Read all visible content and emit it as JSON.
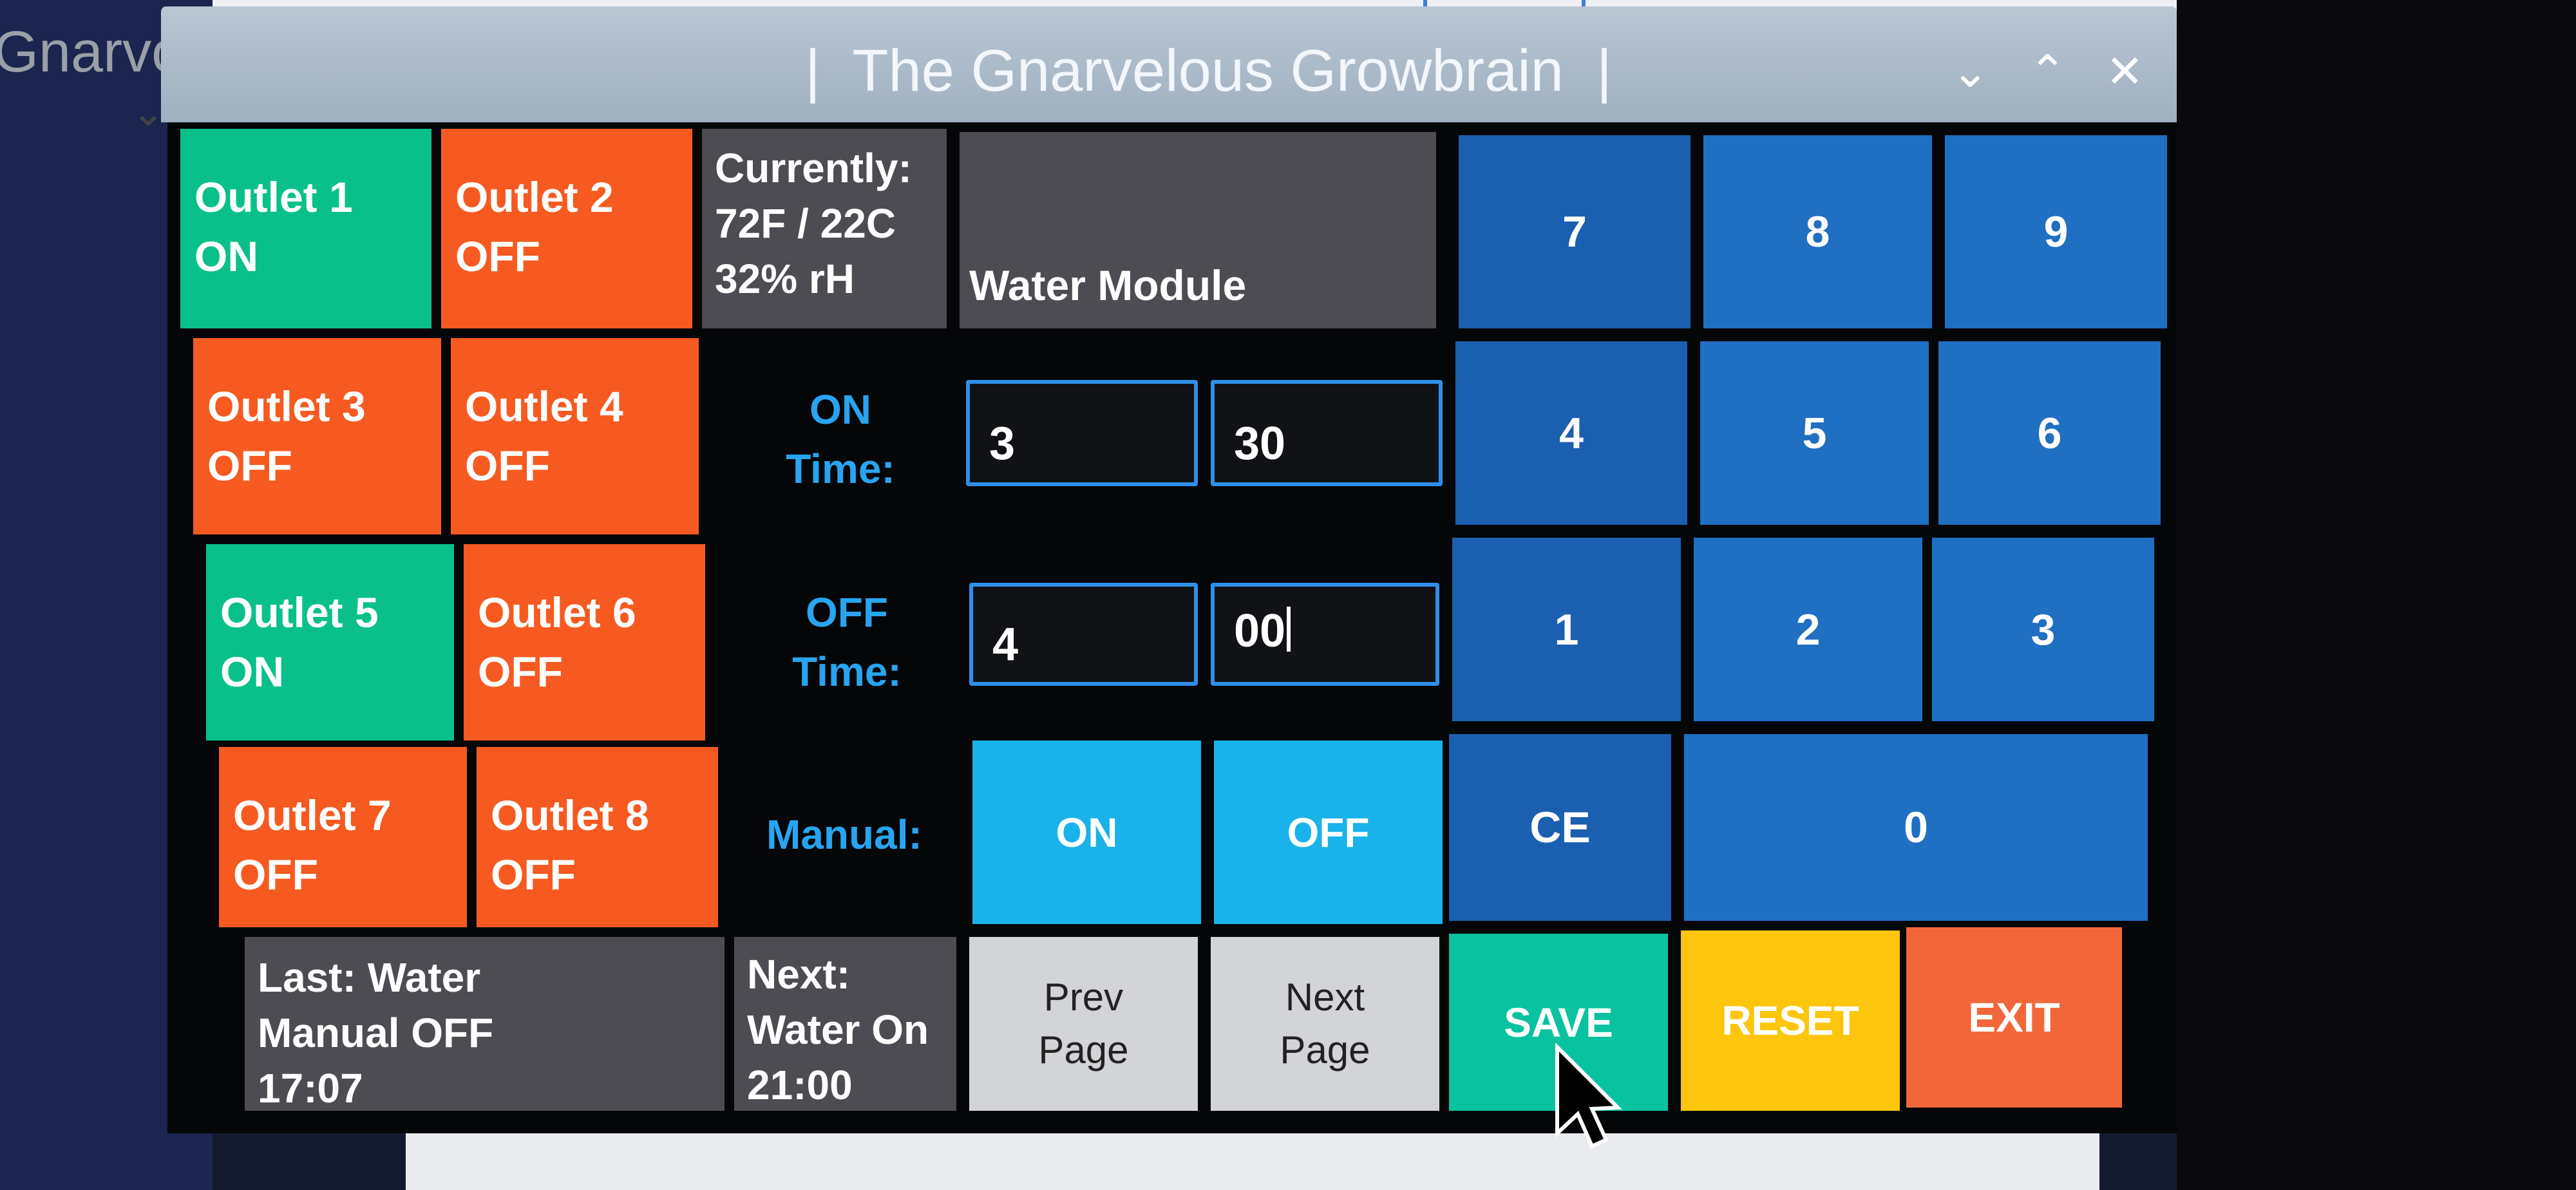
{
  "window": {
    "title": "|  The Gnarvelous Growbrain  |",
    "controls": {
      "minimize": "⌄",
      "maximize": "⌃",
      "close": "✕"
    }
  },
  "background": {
    "ghost_text": "Gnarvo"
  },
  "outlets": [
    {
      "name": "Outlet 1",
      "state": "ON"
    },
    {
      "name": "Outlet 2",
      "state": "OFF"
    },
    {
      "name": "Outlet 3",
      "state": "OFF"
    },
    {
      "name": "Outlet 4",
      "state": "OFF"
    },
    {
      "name": "Outlet 5",
      "state": "ON"
    },
    {
      "name": "Outlet 6",
      "state": "OFF"
    },
    {
      "name": "Outlet 7",
      "state": "OFF"
    },
    {
      "name": "Outlet 8",
      "state": "OFF"
    }
  ],
  "currently": {
    "label": "Currently:",
    "temp": "72F / 22C",
    "humidity": "32% rH"
  },
  "module": {
    "title": "Water Module"
  },
  "on_time": {
    "label_1": "ON",
    "label_2": "Time:",
    "hours": "3",
    "minutes": "30"
  },
  "off_time": {
    "label_1": "OFF",
    "label_2": "Time:",
    "hours": "4",
    "minutes": "00"
  },
  "manual": {
    "label": "Manual:",
    "on": "ON",
    "off": "OFF"
  },
  "keypad": {
    "k7": "7",
    "k8": "8",
    "k9": "9",
    "k4": "4",
    "k5": "5",
    "k6": "6",
    "k1": "1",
    "k2": "2",
    "k3": "3",
    "ce": "CE",
    "k0": "0"
  },
  "last": {
    "line1": "Last: Water",
    "line2": "Manual OFF",
    "time": "17:07"
  },
  "next": {
    "line1": "Next:",
    "line2": "Water On",
    "time": "21:00"
  },
  "nav": {
    "prev_1": "Prev",
    "prev_2": "Page",
    "next_1": "Next",
    "next_2": "Page"
  },
  "actions": {
    "save": "SAVE",
    "reset": "RESET",
    "exit": "EXIT"
  },
  "colors": {
    "on": "#0ac08a",
    "off": "#f65a20",
    "keypad": "#1f6fc2",
    "manual": "#1ab2ea",
    "save": "#09c3a0",
    "reset": "#fdc60c",
    "exit": "#f2673a",
    "label": "#28a4f0"
  }
}
